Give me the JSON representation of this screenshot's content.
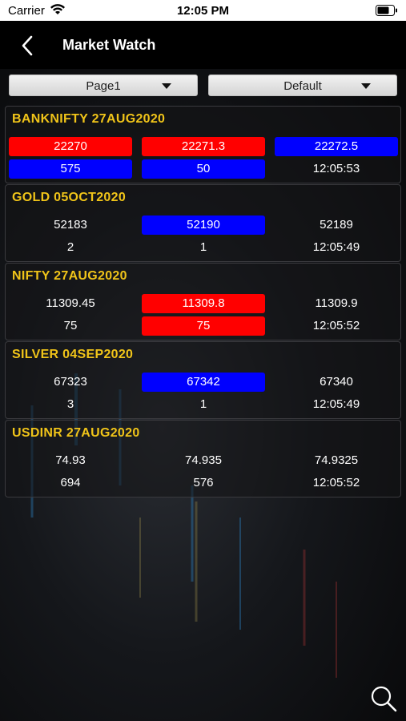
{
  "status": {
    "carrier": "Carrier",
    "time": "12:05 PM"
  },
  "nav": {
    "title": "Market Watch"
  },
  "filters": {
    "page": "Page1",
    "view": "Default"
  },
  "watchlist": [
    {
      "symbol": "BANKNIFTY 27AUG2020",
      "row1": [
        "22270",
        "22271.3",
        "22272.5"
      ],
      "row2": [
        "575",
        "50",
        "12:05:53"
      ]
    },
    {
      "symbol": "GOLD 05OCT2020",
      "row1": [
        "52183",
        "52190",
        "52189"
      ],
      "row2": [
        "2",
        "1",
        "12:05:49"
      ]
    },
    {
      "symbol": "NIFTY 27AUG2020",
      "row1": [
        "11309.45",
        "11309.8",
        "11309.9"
      ],
      "row2": [
        "75",
        "75",
        "12:05:52"
      ]
    },
    {
      "symbol": "SILVER 04SEP2020",
      "row1": [
        "67323",
        "67342",
        "67340"
      ],
      "row2": [
        "3",
        "1",
        "12:05:49"
      ]
    },
    {
      "symbol": "USDINR 27AUG2020",
      "row1": [
        "74.93",
        "74.935",
        "74.9325"
      ],
      "row2": [
        "694",
        "576",
        "12:05:52"
      ]
    }
  ],
  "colors": {
    "up": "#0000ff",
    "down": "#ff0000",
    "symbol": "#f0c419"
  }
}
